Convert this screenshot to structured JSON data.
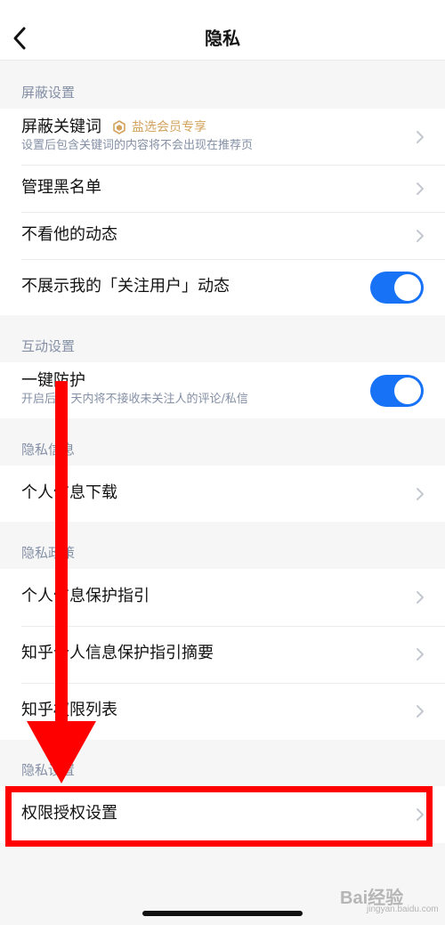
{
  "navbar": {
    "title": "隐私",
    "back_icon": "chevron-left-icon"
  },
  "sections": {
    "block": {
      "header": "屏蔽设置",
      "keywords": {
        "title": "屏蔽关键词",
        "badge": "盐选会员专享",
        "subtitle": "设置后包含关键词的内容将不会出现在推荐页"
      },
      "blacklist": {
        "title": "管理黑名单"
      },
      "hide_activity": {
        "title": "不看他的动态"
      },
      "hide_follow": {
        "title": "不展示我的「关注用户」动态",
        "toggle_on": true
      }
    },
    "interaction": {
      "header": "互动设置",
      "protect": {
        "title": "一键防护",
        "subtitle": "开启后 7 天内将不接收未关注人的评论/私信",
        "toggle_on": true
      }
    },
    "info": {
      "header": "隐私信息",
      "download": {
        "title": "个人信息下载"
      }
    },
    "policy": {
      "header": "隐私政策",
      "guide": {
        "title": "个人信息保护指引"
      },
      "guide_summary": {
        "title": "知乎个人信息保护指引摘要"
      },
      "permission_list": {
        "title": "知乎权限列表"
      }
    },
    "privacy_settings": {
      "header": "隐私设置",
      "permission_auth": {
        "title": "权限授权设置"
      }
    }
  },
  "colors": {
    "accent": "#1772f6",
    "annotation": "#ff0000",
    "vip_gold": "#d2a35d",
    "secondary_text": "#8590a6"
  },
  "watermark": {
    "text": "Bai经验",
    "sub": "jingyan.baidu.com"
  }
}
